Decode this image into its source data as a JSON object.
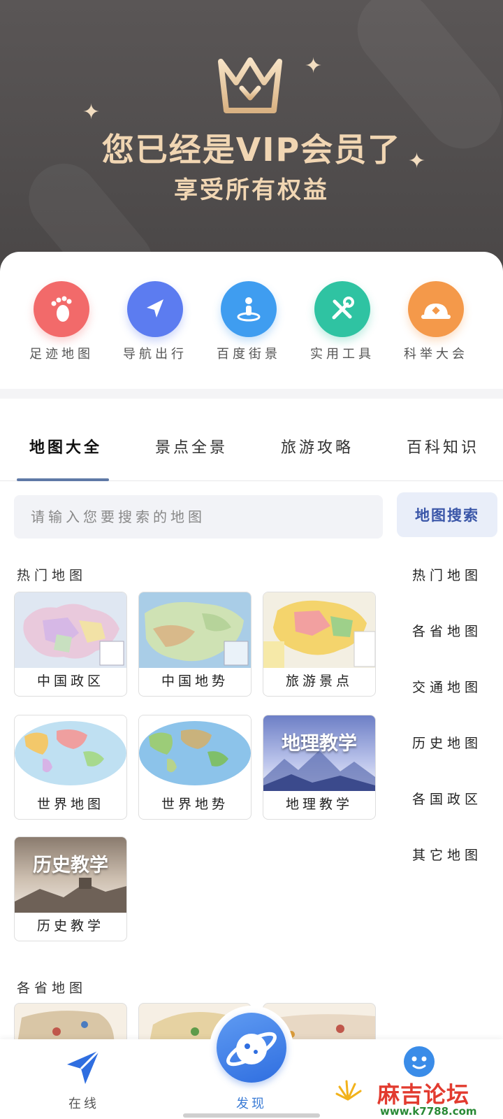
{
  "colors": {
    "banner_bg": "#4f4c4c",
    "gold_text": "#f1d6b3",
    "accent_blue": "#3a56a8",
    "tab_underline": "#5f79a6"
  },
  "vip": {
    "title": "您已经是VIP会员了",
    "subtitle": "享受所有权益"
  },
  "quick_links": [
    {
      "label": "足迹地图",
      "icon": "footprint-icon",
      "color": "#f26a6a"
    },
    {
      "label": "导航出行",
      "icon": "navigation-arrow-icon",
      "color": "#5c7cf0"
    },
    {
      "label": "百度街景",
      "icon": "street-view-person-icon",
      "color": "#3f9df0"
    },
    {
      "label": "实用工具",
      "icon": "tools-icon",
      "color": "#2fc3a2"
    },
    {
      "label": "科举大会",
      "icon": "exam-hat-icon",
      "color": "#f4994a"
    }
  ],
  "tabs": [
    {
      "label": "地图大全",
      "active": true
    },
    {
      "label": "景点全景",
      "active": false
    },
    {
      "label": "旅游攻略",
      "active": false
    },
    {
      "label": "百科知识",
      "active": false
    }
  ],
  "search": {
    "placeholder": "请输入您要搜索的地图",
    "button_label": "地图搜索"
  },
  "hot_maps": {
    "title": "热门地图",
    "items": [
      {
        "label": "中国政区",
        "thumb": "china-political-map"
      },
      {
        "label": "中国地势",
        "thumb": "china-terrain-map"
      },
      {
        "label": "旅游景点",
        "thumb": "tourism-map"
      },
      {
        "label": "世界地图",
        "thumb": "world-political-map"
      },
      {
        "label": "世界地势",
        "thumb": "world-terrain-map"
      },
      {
        "label": "地理教学",
        "thumb": "geography-teaching",
        "thumb_title": "地理教学"
      },
      {
        "label": "历史教学",
        "thumb": "history-teaching",
        "thumb_title": "历史教学"
      }
    ]
  },
  "categories": [
    "热门地图",
    "各省地图",
    "交通地图",
    "历史地图",
    "各国政区",
    "其它地图"
  ],
  "province_section": {
    "title": "各省地图"
  },
  "bottom_nav": [
    {
      "label": "在线",
      "icon": "paper-plane-icon",
      "active": false
    },
    {
      "label": "发现",
      "icon": "planet-icon",
      "active": true
    },
    {
      "label": "",
      "icon": "smiley-face-icon",
      "active": false
    }
  ],
  "watermark": {
    "text": "麻吉论坛",
    "url": "www.k7788.com"
  }
}
